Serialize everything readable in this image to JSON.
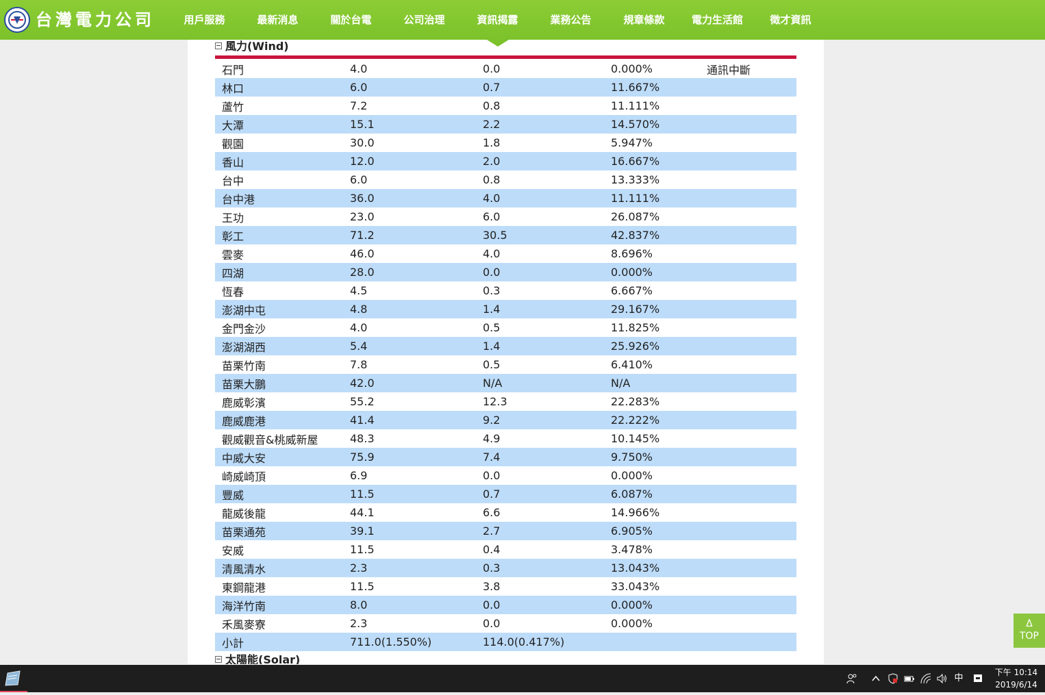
{
  "logo": {
    "text": "台灣電力公司",
    "icon": "taipower-emblem"
  },
  "nav": [
    "用戶服務",
    "最新消息",
    "關於台電",
    "公司治理",
    "資訊揭露",
    "業務公告",
    "規章條款",
    "電力生活館",
    "徵才資訊"
  ],
  "nav_active": "資訊揭露",
  "sections": {
    "wind_title": "風力(Wind)",
    "solar_title": "太陽能(Solar)"
  },
  "wind_rows": [
    [
      "石門",
      "4.0",
      "0.0",
      "0.000%",
      "通訊中斷"
    ],
    [
      "林口",
      "6.0",
      "0.7",
      "11.667%",
      ""
    ],
    [
      "蘆竹",
      "7.2",
      "0.8",
      "11.111%",
      ""
    ],
    [
      "大潭",
      "15.1",
      "2.2",
      "14.570%",
      ""
    ],
    [
      "觀園",
      "30.0",
      "1.8",
      "5.947%",
      ""
    ],
    [
      "香山",
      "12.0",
      "2.0",
      "16.667%",
      ""
    ],
    [
      "台中",
      "6.0",
      "0.8",
      "13.333%",
      ""
    ],
    [
      "台中港",
      "36.0",
      "4.0",
      "11.111%",
      ""
    ],
    [
      "王功",
      "23.0",
      "6.0",
      "26.087%",
      ""
    ],
    [
      "彰工",
      "71.2",
      "30.5",
      "42.837%",
      ""
    ],
    [
      "雲麥",
      "46.0",
      "4.0",
      "8.696%",
      ""
    ],
    [
      "四湖",
      "28.0",
      "0.0",
      "0.000%",
      ""
    ],
    [
      "恆春",
      "4.5",
      "0.3",
      "6.667%",
      ""
    ],
    [
      "澎湖中屯",
      "4.8",
      "1.4",
      "29.167%",
      ""
    ],
    [
      "金門金沙",
      "4.0",
      "0.5",
      "11.825%",
      ""
    ],
    [
      "澎湖湖西",
      "5.4",
      "1.4",
      "25.926%",
      ""
    ],
    [
      "苗栗竹南",
      "7.8",
      "0.5",
      "6.410%",
      ""
    ],
    [
      "苗栗大鵬",
      "42.0",
      "N/A",
      "N/A",
      ""
    ],
    [
      "鹿威彰濱",
      "55.2",
      "12.3",
      "22.283%",
      ""
    ],
    [
      "鹿威鹿港",
      "41.4",
      "9.2",
      "22.222%",
      ""
    ],
    [
      "觀威觀音&桃威新屋",
      "48.3",
      "4.9",
      "10.145%",
      ""
    ],
    [
      "中威大安",
      "75.9",
      "7.4",
      "9.750%",
      ""
    ],
    [
      "崎威崎頂",
      "6.9",
      "0.0",
      "0.000%",
      ""
    ],
    [
      "豐威",
      "11.5",
      "0.7",
      "6.087%",
      ""
    ],
    [
      "龍威後龍",
      "44.1",
      "6.6",
      "14.966%",
      ""
    ],
    [
      "苗栗通苑",
      "39.1",
      "2.7",
      "6.905%",
      ""
    ],
    [
      "安威",
      "11.5",
      "0.4",
      "3.478%",
      ""
    ],
    [
      "清風清水",
      "2.3",
      "0.3",
      "13.043%",
      ""
    ],
    [
      "東鋼龍港",
      "11.5",
      "3.8",
      "33.043%",
      ""
    ],
    [
      "海洋竹南",
      "8.0",
      "0.0",
      "0.000%",
      ""
    ],
    [
      "禾風麥寮",
      "2.3",
      "0.0",
      "0.000%",
      ""
    ]
  ],
  "subtotal": [
    "小計",
    "711.0(1.550%)",
    "114.0(0.417%)",
    "",
    ""
  ],
  "top_button": {
    "arrow": "Δ",
    "label": "TOP"
  },
  "taskbar": {
    "time": "下午 10:14",
    "date": "2019/6/14",
    "ime": "中",
    "tray_icons": [
      "people-icon",
      "chevron-up-icon",
      "security-shield-icon",
      "battery-icon",
      "wifi-icon",
      "volume-icon",
      "ime-icon",
      "notification-icon"
    ]
  },
  "colors": {
    "nav_green": "#7cc22a",
    "row_blue": "#bddcf9",
    "rule_red": "#c8153c",
    "top_btn": "#8cc63f"
  }
}
